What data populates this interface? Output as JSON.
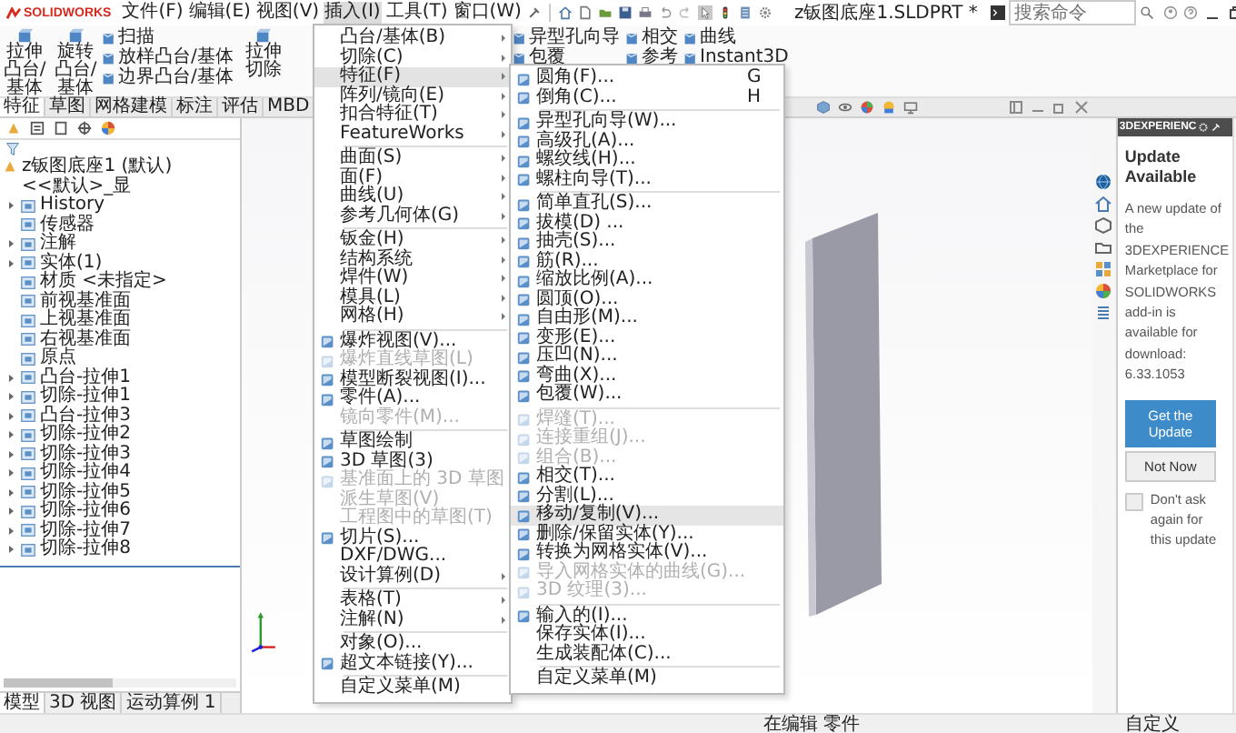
{
  "titlebar": {
    "logo": "SOLIDWORKS",
    "menus": [
      {
        "label": "文件(F)",
        "selected": false
      },
      {
        "label": "编辑(E)",
        "selected": false
      },
      {
        "label": "视图(V)",
        "selected": false
      },
      {
        "label": "插入(I)",
        "selected": true
      },
      {
        "label": "工具(T)",
        "selected": false
      },
      {
        "label": "窗口(W)",
        "selected": false
      }
    ],
    "document_title": "z钣图底座1.SLDPRT *",
    "search": {
      "placeholder": "搜索命令"
    }
  },
  "ribbon": {
    "left": [
      {
        "kind": "large",
        "label": "拉伸凸台/基体"
      },
      {
        "kind": "large",
        "label": "旋转凸台/基体"
      },
      {
        "kind": "stack",
        "items": [
          "扫描",
          "放样凸台/基体",
          "边界凸台/基体"
        ]
      },
      {
        "kind": "large",
        "label": "拉伸切除"
      }
    ],
    "right": [
      {
        "kind": "stack",
        "items": [
          "异型孔向导",
          "包覆"
        ]
      },
      {
        "kind": "stack",
        "items": [
          "相交",
          "参考"
        ]
      },
      {
        "kind": "stack",
        "items": [
          "曲线",
          "Instant3D"
        ]
      }
    ]
  },
  "command_tabs": [
    {
      "label": "特征",
      "selected": true
    },
    {
      "label": "草图",
      "selected": false
    },
    {
      "label": "网格建模",
      "selected": false
    },
    {
      "label": "标注",
      "selected": false
    },
    {
      "label": "评估",
      "selected": false
    },
    {
      "label": "MBD",
      "selected": false
    }
  ],
  "feature_tree": {
    "label": "z钣图底座1 (默认) <<默认>_显",
    "children": [
      {
        "label": "History",
        "expanded": false
      },
      {
        "label": "传感器"
      },
      {
        "label": "注解",
        "expanded": false
      },
      {
        "label": "实体(1)",
        "expanded": false
      },
      {
        "label": "材质 <未指定>"
      },
      {
        "label": "前视基准面"
      },
      {
        "label": "上视基准面"
      },
      {
        "label": "右视基准面"
      },
      {
        "label": "原点"
      },
      {
        "label": "凸台-拉伸1",
        "expanded": false
      },
      {
        "label": "切除-拉伸1",
        "expanded": false
      },
      {
        "label": "凸台-拉伸3",
        "expanded": false
      },
      {
        "label": "切除-拉伸2",
        "expanded": false
      },
      {
        "label": "切除-拉伸3",
        "expanded": false
      },
      {
        "label": "切除-拉伸4",
        "expanded": false
      },
      {
        "label": "切除-拉伸5",
        "expanded": false
      },
      {
        "label": "切除-拉伸6",
        "expanded": false
      },
      {
        "label": "切除-拉伸7",
        "expanded": false
      },
      {
        "label": "切除-拉伸8",
        "expanded": false
      }
    ]
  },
  "bottom_tabs": [
    {
      "label": "模型",
      "selected": true
    },
    {
      "label": "3D 视图",
      "selected": false
    },
    {
      "label": "运动算例 1",
      "selected": false
    }
  ],
  "insert_menu": [
    {
      "kind": "item",
      "label": "凸台/基体(B)",
      "submenu": true,
      "disabled": false,
      "has_icon": false,
      "selected": false
    },
    {
      "kind": "item",
      "label": "切除(C)",
      "submenu": true,
      "disabled": false,
      "has_icon": false,
      "selected": false
    },
    {
      "kind": "item",
      "label": "特征(F)",
      "submenu": true,
      "disabled": false,
      "has_icon": false,
      "selected": true
    },
    {
      "kind": "item",
      "label": "阵列/镜向(E)",
      "submenu": true,
      "disabled": false,
      "has_icon": false,
      "selected": false
    },
    {
      "kind": "item",
      "label": "扣合特征(T)",
      "submenu": true,
      "disabled": false,
      "has_icon": false,
      "selected": false
    },
    {
      "kind": "item",
      "label": "FeatureWorks",
      "submenu": true,
      "disabled": false,
      "has_icon": false,
      "selected": false
    },
    {
      "kind": "separator"
    },
    {
      "kind": "item",
      "label": "曲面(S)",
      "submenu": true,
      "disabled": false,
      "has_icon": false,
      "selected": false
    },
    {
      "kind": "item",
      "label": "面(F)",
      "submenu": true,
      "disabled": false,
      "has_icon": false,
      "selected": false
    },
    {
      "kind": "item",
      "label": "曲线(U)",
      "submenu": true,
      "disabled": false,
      "has_icon": false,
      "selected": false
    },
    {
      "kind": "item",
      "label": "参考几何体(G)",
      "submenu": true,
      "disabled": false,
      "has_icon": false,
      "selected": false
    },
    {
      "kind": "separator"
    },
    {
      "kind": "item",
      "label": "钣金(H)",
      "submenu": true,
      "disabled": false,
      "has_icon": false,
      "selected": false
    },
    {
      "kind": "item",
      "label": "结构系统",
      "submenu": true,
      "disabled": false,
      "has_icon": false,
      "selected": false
    },
    {
      "kind": "item",
      "label": "焊件(W)",
      "submenu": true,
      "disabled": false,
      "has_icon": false,
      "selected": false
    },
    {
      "kind": "item",
      "label": "模具(L)",
      "submenu": true,
      "disabled": false,
      "has_icon": false,
      "selected": false
    },
    {
      "kind": "item",
      "label": "网格(H)",
      "submenu": true,
      "disabled": false,
      "has_icon": false,
      "selected": false
    },
    {
      "kind": "separator"
    },
    {
      "kind": "item",
      "label": "爆炸视图(V)...",
      "submenu": false,
      "disabled": false,
      "has_icon": true,
      "selected": false
    },
    {
      "kind": "item",
      "label": "爆炸直线草图(L)",
      "submenu": false,
      "disabled": true,
      "has_icon": true,
      "selected": false
    },
    {
      "kind": "item",
      "label": "模型断裂视图(I)...",
      "submenu": false,
      "disabled": false,
      "has_icon": true,
      "selected": false
    },
    {
      "kind": "item",
      "label": "零件(A)...",
      "submenu": false,
      "disabled": false,
      "has_icon": true,
      "selected": false
    },
    {
      "kind": "item",
      "label": "镜向零件(M)...",
      "submenu": false,
      "disabled": true,
      "has_icon": false,
      "selected": false
    },
    {
      "kind": "separator"
    },
    {
      "kind": "item",
      "label": "草图绘制",
      "submenu": false,
      "disabled": false,
      "has_icon": true,
      "selected": false
    },
    {
      "kind": "item",
      "label": "3D 草图(3)",
      "submenu": false,
      "disabled": false,
      "has_icon": true,
      "selected": false
    },
    {
      "kind": "item",
      "label": "基准面上的 3D 草图",
      "submenu": false,
      "disabled": true,
      "has_icon": true,
      "selected": false
    },
    {
      "kind": "item",
      "label": "派生草图(V)",
      "submenu": false,
      "disabled": true,
      "has_icon": false,
      "selected": false
    },
    {
      "kind": "item",
      "label": "工程图中的草图(T)",
      "submenu": false,
      "disabled": true,
      "has_icon": false,
      "selected": false
    },
    {
      "kind": "item",
      "label": "切片(S)...",
      "submenu": false,
      "disabled": false,
      "has_icon": true,
      "selected": false
    },
    {
      "kind": "item",
      "label": "DXF/DWG...",
      "submenu": false,
      "disabled": false,
      "has_icon": false,
      "selected": false
    },
    {
      "kind": "item",
      "label": "设计算例(D)",
      "submenu": true,
      "disabled": false,
      "has_icon": false,
      "selected": false
    },
    {
      "kind": "separator"
    },
    {
      "kind": "item",
      "label": "表格(T)",
      "submenu": true,
      "disabled": false,
      "has_icon": false,
      "selected": false
    },
    {
      "kind": "item",
      "label": "注解(N)",
      "submenu": true,
      "disabled": false,
      "has_icon": false,
      "selected": false
    },
    {
      "kind": "separator"
    },
    {
      "kind": "item",
      "label": "对象(O)...",
      "submenu": false,
      "disabled": false,
      "has_icon": false,
      "selected": false
    },
    {
      "kind": "item",
      "label": "超文本链接(Y)...",
      "submenu": false,
      "disabled": false,
      "has_icon": true,
      "selected": false
    },
    {
      "kind": "separator"
    },
    {
      "kind": "item",
      "label": "自定义菜单(M)",
      "submenu": false,
      "disabled": false,
      "has_icon": false,
      "selected": false
    }
  ],
  "features_submenu": [
    {
      "kind": "item",
      "label": "圆角(F)...",
      "shortcut": "G",
      "disabled": false,
      "has_icon": true,
      "selected": false
    },
    {
      "kind": "item",
      "label": "倒角(C)...",
      "shortcut": "H",
      "disabled": false,
      "has_icon": true,
      "selected": false
    },
    {
      "kind": "separator"
    },
    {
      "kind": "item",
      "label": "异型孔向导(W)...",
      "disabled": false,
      "has_icon": true,
      "selected": false
    },
    {
      "kind": "item",
      "label": "高级孔(A)...",
      "disabled": false,
      "has_icon": true,
      "selected": false
    },
    {
      "kind": "item",
      "label": "螺纹线(H)...",
      "disabled": false,
      "has_icon": true,
      "selected": false
    },
    {
      "kind": "item",
      "label": "螺柱向导(T)...",
      "disabled": false,
      "has_icon": true,
      "selected": false
    },
    {
      "kind": "separator"
    },
    {
      "kind": "item",
      "label": "简单直孔(S)...",
      "disabled": false,
      "has_icon": true,
      "selected": false
    },
    {
      "kind": "item",
      "label": "拔模(D) ...",
      "disabled": false,
      "has_icon": true,
      "selected": false
    },
    {
      "kind": "item",
      "label": "抽壳(S)...",
      "disabled": false,
      "has_icon": true,
      "selected": false
    },
    {
      "kind": "item",
      "label": "筋(R)...",
      "disabled": false,
      "has_icon": true,
      "selected": false
    },
    {
      "kind": "item",
      "label": "缩放比例(A)...",
      "disabled": false,
      "has_icon": true,
      "selected": false
    },
    {
      "kind": "item",
      "label": "圆顶(O)...",
      "disabled": false,
      "has_icon": true,
      "selected": false
    },
    {
      "kind": "item",
      "label": "自由形(M)...",
      "disabled": false,
      "has_icon": true,
      "selected": false
    },
    {
      "kind": "item",
      "label": "变形(E)...",
      "disabled": false,
      "has_icon": true,
      "selected": false
    },
    {
      "kind": "item",
      "label": "压凹(N)...",
      "disabled": false,
      "has_icon": true,
      "selected": false
    },
    {
      "kind": "item",
      "label": "弯曲(X)...",
      "disabled": false,
      "has_icon": true,
      "selected": false
    },
    {
      "kind": "item",
      "label": "包覆(W)...",
      "disabled": false,
      "has_icon": true,
      "selected": false
    },
    {
      "kind": "separator"
    },
    {
      "kind": "item",
      "label": "焊缝(T)...",
      "disabled": true,
      "has_icon": true,
      "selected": false
    },
    {
      "kind": "item",
      "label": "连接重组(J)...",
      "disabled": true,
      "has_icon": true,
      "selected": false
    },
    {
      "kind": "item",
      "label": "组合(B)...",
      "disabled": true,
      "has_icon": true,
      "selected": false
    },
    {
      "kind": "item",
      "label": "相交(T)...",
      "disabled": false,
      "has_icon": true,
      "selected": false
    },
    {
      "kind": "item",
      "label": "分割(L)...",
      "disabled": false,
      "has_icon": true,
      "selected": false
    },
    {
      "kind": "item",
      "label": "移动/复制(V)...",
      "disabled": false,
      "has_icon": true,
      "selected": true
    },
    {
      "kind": "item",
      "label": "删除/保留实体(Y)...",
      "disabled": false,
      "has_icon": true,
      "selected": false
    },
    {
      "kind": "item",
      "label": "转换为网格实体(V)...",
      "disabled": false,
      "has_icon": true,
      "selected": false
    },
    {
      "kind": "item",
      "label": "导入网格实体的曲线(G)...",
      "disabled": true,
      "has_icon": true,
      "selected": false
    },
    {
      "kind": "item",
      "label": "3D 纹理(3)...",
      "disabled": true,
      "has_icon": true,
      "selected": false
    },
    {
      "kind": "separator"
    },
    {
      "kind": "item",
      "label": "输入的(I)...",
      "disabled": false,
      "has_icon": true,
      "selected": false
    },
    {
      "kind": "item",
      "label": "保存实体(I)...",
      "disabled": false,
      "has_icon": false,
      "selected": false
    },
    {
      "kind": "item",
      "label": "生成装配体(C)...",
      "disabled": false,
      "has_icon": false,
      "selected": false
    },
    {
      "kind": "separator"
    },
    {
      "kind": "item",
      "label": "自定义菜单(M)",
      "disabled": false,
      "has_icon": false,
      "selected": false
    }
  ],
  "task_pane": {
    "title": "3DEXPERIENC",
    "heading": "Update Available",
    "message": "A new update of the 3DEXPERIENCE Marketplace for SOLIDWORKS add-in is available for download: 6.33.1053",
    "primary_button": "Get the Update",
    "secondary_button": "Not Now",
    "dont_ask": {
      "label": "Don't ask again for this update",
      "checked": false
    }
  },
  "status_bar": {
    "left": "在编辑 零件",
    "right": "自定义"
  }
}
